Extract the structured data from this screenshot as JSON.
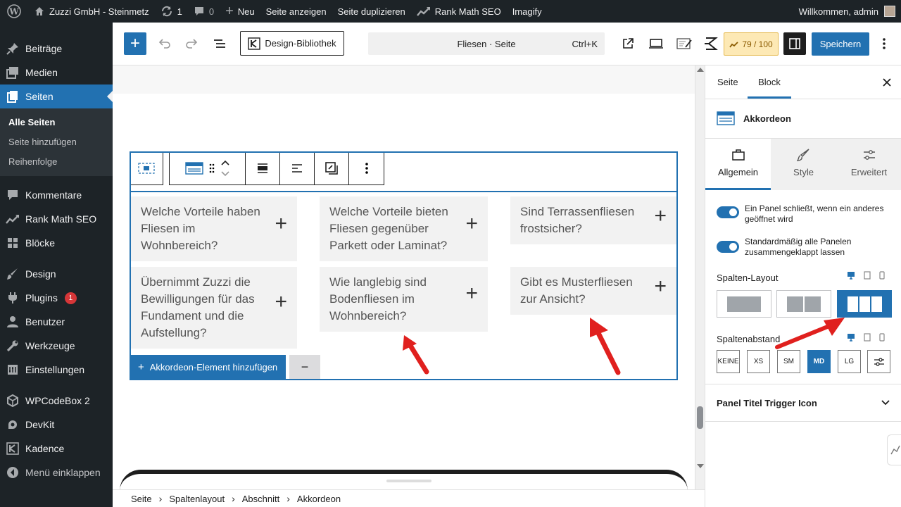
{
  "adminbar": {
    "site_name": "Zuzzi GmbH - Steinmetz",
    "updates": "1",
    "comments": "0",
    "new": "Neu",
    "view_page": "Seite anzeigen",
    "duplicate": "Seite duplizieren",
    "rankmath": "Rank Math SEO",
    "imagify": "Imagify",
    "greeting": "Willkommen, admin"
  },
  "sidebar": {
    "items": [
      {
        "label": "Beiträge",
        "icon": "pin-icon"
      },
      {
        "label": "Medien",
        "icon": "media-icon"
      },
      {
        "label": "Seiten",
        "icon": "pages-icon"
      },
      {
        "label": "Kommentare",
        "icon": "comment-icon"
      },
      {
        "label": "Rank Math SEO",
        "icon": "rankmath-icon"
      },
      {
        "label": "Blöcke",
        "icon": "blocks-icon"
      },
      {
        "label": "Design",
        "icon": "brush-icon"
      },
      {
        "label": "Plugins",
        "icon": "plugin-icon",
        "badge": "1"
      },
      {
        "label": "Benutzer",
        "icon": "user-icon"
      },
      {
        "label": "Werkzeuge",
        "icon": "wrench-icon"
      },
      {
        "label": "Einstellungen",
        "icon": "settings-icon"
      },
      {
        "label": "WPCodeBox 2",
        "icon": "code-icon"
      },
      {
        "label": "DevKit",
        "icon": "devkit-icon"
      },
      {
        "label": "Kadence",
        "icon": "kadence-icon"
      },
      {
        "label": "Menü einklappen",
        "icon": "collapse-icon"
      }
    ],
    "submenu": [
      "Alle Seiten",
      "Seite hinzufügen",
      "Reihenfolge"
    ]
  },
  "header": {
    "design_library": "Design-Bibliothek",
    "command_title": "Fliesen · Seite",
    "shortcut": "Ctrl+K",
    "score": "79 / 100",
    "save": "Speichern"
  },
  "accordion": {
    "items": [
      "Welche Vorteile haben Fliesen im Wohnbereich?",
      "Welche Vorteile bieten Fliesen gegenüber Parkett oder Laminat?",
      "Sind Terrassenfliesen frostsicher?",
      "Übernimmt Zuzzi die Bewilligungen für das Fundament und die Aufstellung?",
      "Wie langlebig sind Bodenfliesen im Wohnbereich?",
      "Gibt es Musterfliesen zur Ansicht?"
    ],
    "add_label": "Akkordeon-Element hinzufügen",
    "remove_label": "−",
    "plus": "+"
  },
  "breadcrumb": [
    "Seite",
    "Spaltenlayout",
    "Abschnitt",
    "Akkordeon"
  ],
  "inspector": {
    "tab_page": "Seite",
    "tab_block": "Block",
    "block_name": "Akkordeon",
    "subtabs": [
      "Allgemein",
      "Style",
      "Erweitert"
    ],
    "toggle1": "Ein Panel schließt, wenn ein anderes geöffnet wird",
    "toggle2": "Standardmäßig alle Panelen zusammengeklappt lassen",
    "columns_label": "Spalten-Layout",
    "gap_label": "Spaltenabstand",
    "gap_options": [
      "KEINE",
      "XS",
      "SM",
      "MD",
      "LG"
    ],
    "gap_selected": "MD",
    "columns_selected": 3,
    "panel_section": "Panel Titel Trigger Icon"
  },
  "colors": {
    "wp_dark": "#1d2327",
    "accent": "#2271b1",
    "arrow": "#e0201e",
    "score_bg": "#fde9b5"
  }
}
